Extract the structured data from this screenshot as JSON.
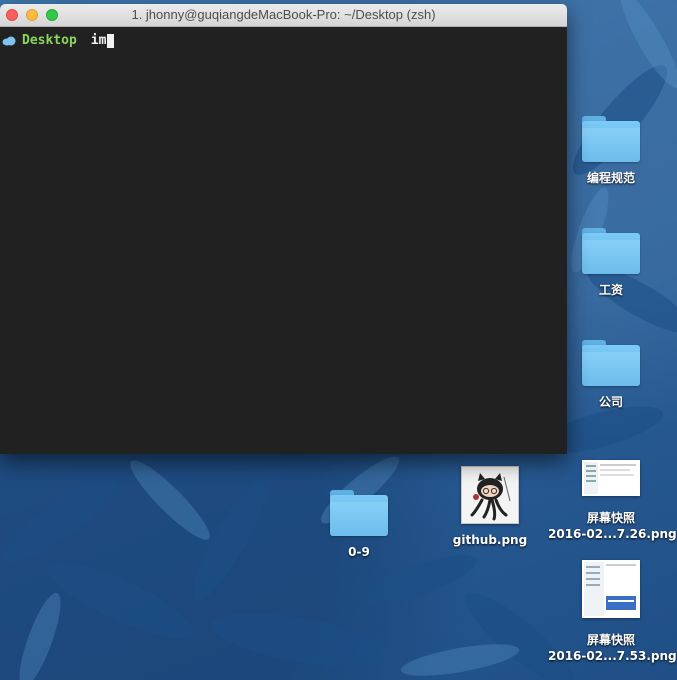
{
  "terminal": {
    "title": "1. jhonny@guqiangdeMacBook-Pro: ~/Desktop (zsh)",
    "prompt_dir": "Desktop",
    "command": "im"
  },
  "desktop": {
    "icons": [
      {
        "label": "编程规范",
        "type": "folder"
      },
      {
        "label": "工资",
        "type": "folder"
      },
      {
        "label": "公司",
        "type": "folder"
      },
      {
        "label": "0-9",
        "type": "folder"
      },
      {
        "label": "github.png",
        "type": "image"
      },
      {
        "label_line1": "屏幕快照",
        "label_line2": "2016-02...7.26.png",
        "type": "image"
      },
      {
        "label_line1": "屏幕快照",
        "label_line2": "2016-02...7.53.png",
        "type": "image"
      }
    ]
  },
  "colors": {
    "terminal_bg": "#212121",
    "prompt_dir": "#8ad55c",
    "folder": "#6cbcec",
    "close": "#fc605c",
    "minimize": "#fdbc40",
    "maximize": "#34c84a"
  }
}
